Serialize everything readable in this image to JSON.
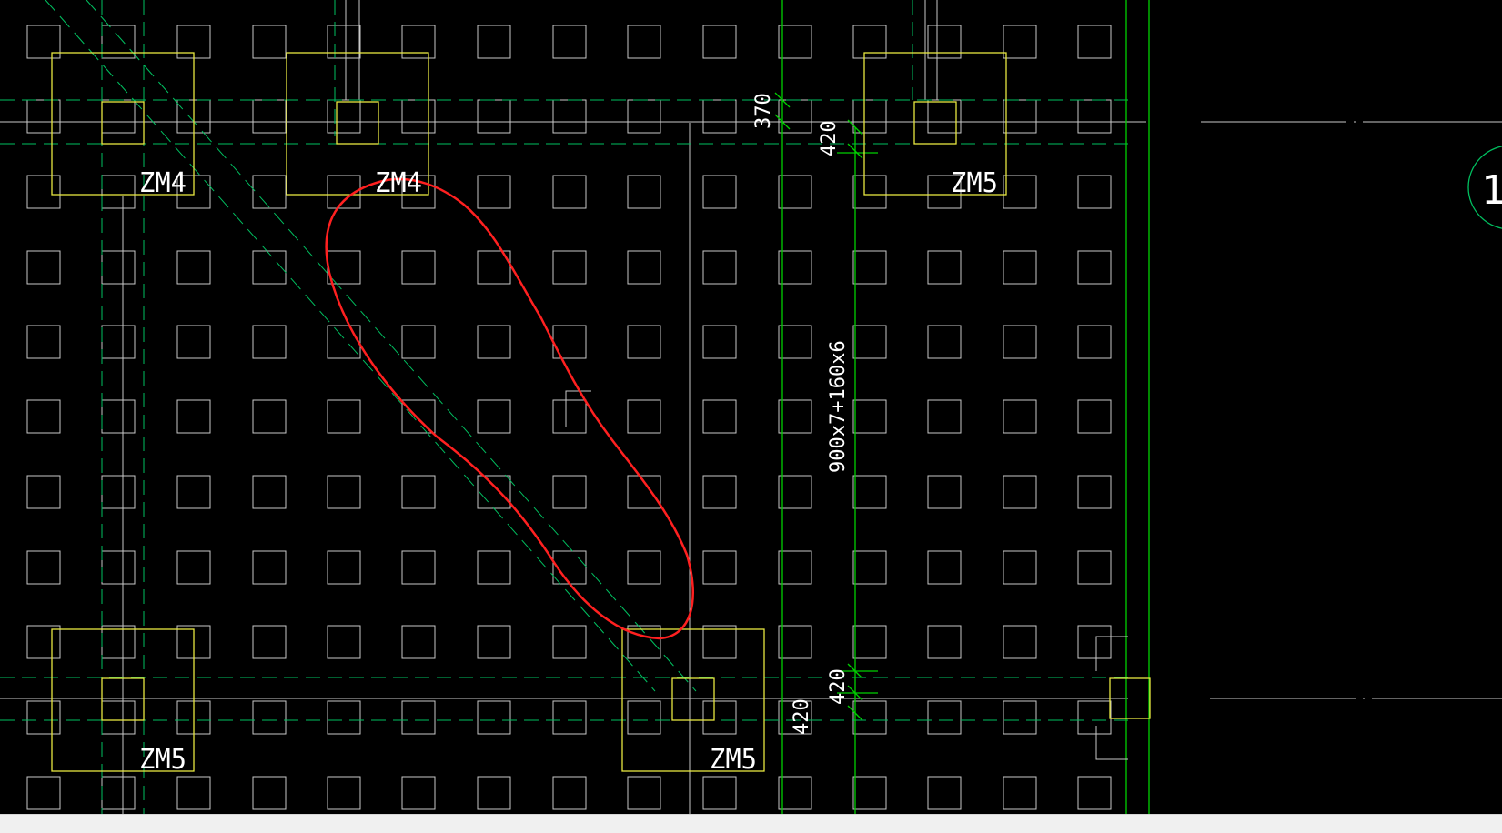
{
  "drawing": {
    "colors": {
      "background": "#000000",
      "grid_lines": "#c8c8c8",
      "axis_lines": "#00c060",
      "dimension_lines": "#00d000",
      "pile_caps": "#e8e840",
      "labels": "#ffffff",
      "highlight": "#ff2020",
      "status_strip": "#f0f0f0"
    },
    "pile_caps": [
      {
        "label": "ZM4"
      },
      {
        "label": "ZM4"
      },
      {
        "label": "ZM5"
      },
      {
        "label": "ZM5"
      },
      {
        "label": "ZM5"
      }
    ],
    "dimensions": {
      "dim_370": "370",
      "dim_420_top": "420",
      "dim_420_lower_a": "420",
      "dim_420_lower_b": "420",
      "span_note": "900x7+160x6"
    },
    "axis_bubble": {
      "label": "1"
    }
  }
}
